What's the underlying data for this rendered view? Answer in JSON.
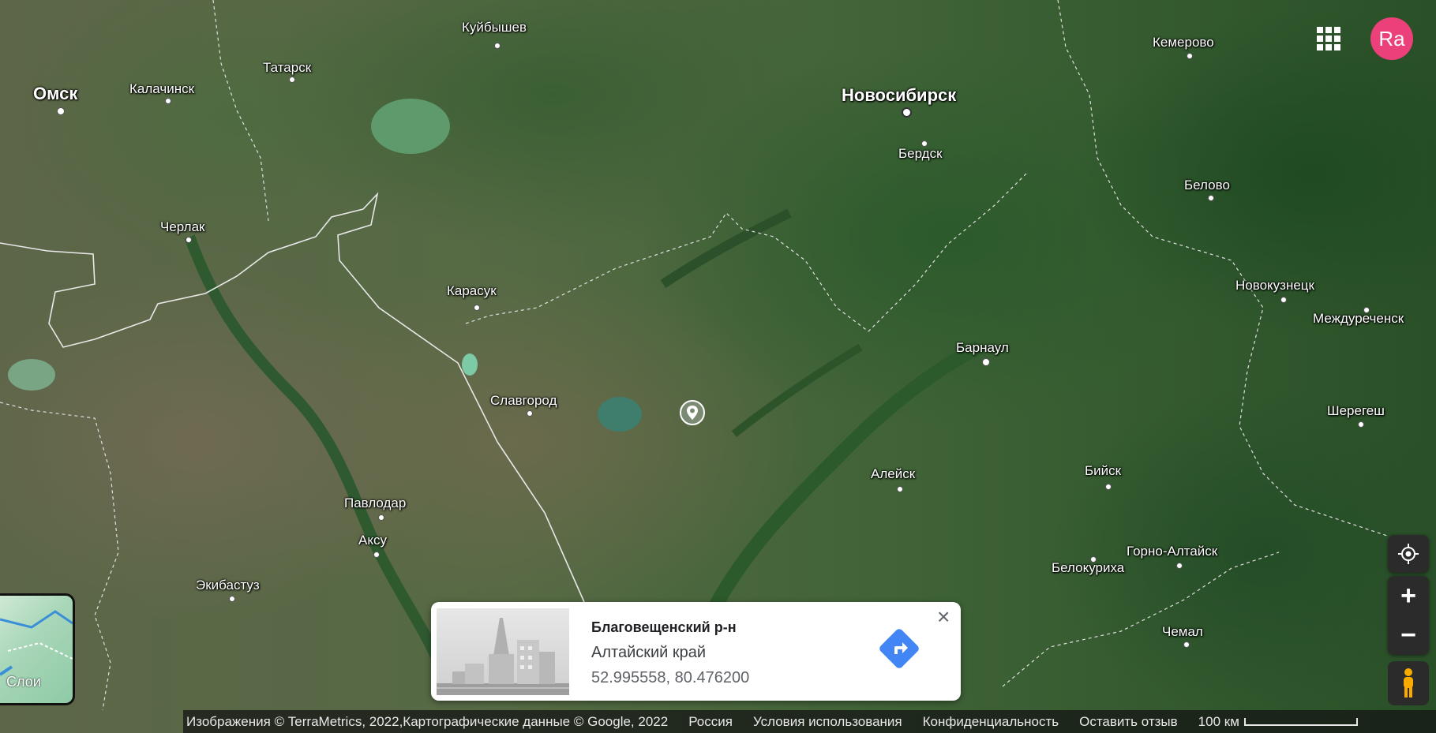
{
  "places": [
    {
      "name": "Омск",
      "big": true
    },
    {
      "name": "Калачинск"
    },
    {
      "name": "Татарск"
    },
    {
      "name": "Куйбышев"
    },
    {
      "name": "Новосибирск",
      "big": true
    },
    {
      "name": "Бердск"
    },
    {
      "name": "Кемерово"
    },
    {
      "name": "Белово"
    },
    {
      "name": "Черлак"
    },
    {
      "name": "Карасук"
    },
    {
      "name": "Новокузнецк"
    },
    {
      "name": "Междуреченск"
    },
    {
      "name": "Барнаул"
    },
    {
      "name": "Славгород"
    },
    {
      "name": "Шерегеш"
    },
    {
      "name": "Алейск"
    },
    {
      "name": "Бийск"
    },
    {
      "name": "Павлодар"
    },
    {
      "name": "Аксу"
    },
    {
      "name": "Горно-Алтайск"
    },
    {
      "name": "Белокуриха"
    },
    {
      "name": "Экибастуз"
    },
    {
      "name": "Чемал"
    }
  ],
  "account": {
    "initials": "Ra"
  },
  "layers": {
    "label": "Слои"
  },
  "info_card": {
    "title": "Благовещенский р-н",
    "subtitle": "Алтайский край",
    "coords": "52.995558, 80.476200",
    "close": "×"
  },
  "footer": {
    "attribution": "Изображения © TerraMetrics, 2022,Картографические данные © Google, 2022",
    "country": "Россия",
    "terms": "Условия использования",
    "privacy": "Конфиденциальность",
    "feedback": "Оставить отзыв",
    "scale": "100 км"
  },
  "controls": {
    "zoom_in": "+",
    "zoom_out": "−"
  },
  "colors": {
    "avatar": "#ec407a",
    "directions": "#4285f4"
  }
}
